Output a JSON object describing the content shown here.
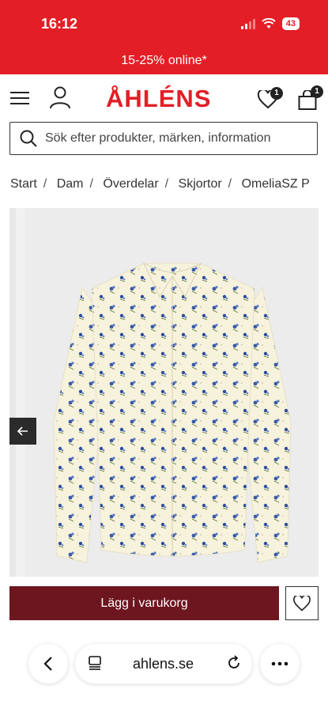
{
  "status_bar": {
    "time": "16:12",
    "battery": "43"
  },
  "promo": {
    "text": "15-25% online*"
  },
  "header": {
    "logo": "ÅHLÉNS",
    "wishlist_count": "1",
    "cart_count": "1"
  },
  "search": {
    "placeholder": "Sök efter produkter, märken, information"
  },
  "breadcrumb": [
    "Start",
    "Dam",
    "Överdelar",
    "Skjortor",
    "OmeliaSZ P"
  ],
  "product": {
    "add_to_cart_label": "Lägg i varukorg"
  },
  "browser": {
    "domain": "ahlens.se"
  },
  "icons": {
    "menu": "hamburger-menu-icon",
    "account": "account-icon",
    "wishlist": "heart-icon",
    "cart": "shopping-bag-icon",
    "search": "search-icon",
    "prev": "arrow-left-icon",
    "back": "chevron-left-icon",
    "tabs": "tabs-icon",
    "reload": "reload-icon",
    "more": "more-icon"
  },
  "colors": {
    "brand": "#e31e26",
    "add_to_cart": "#6d1620",
    "badge": "#222222"
  }
}
